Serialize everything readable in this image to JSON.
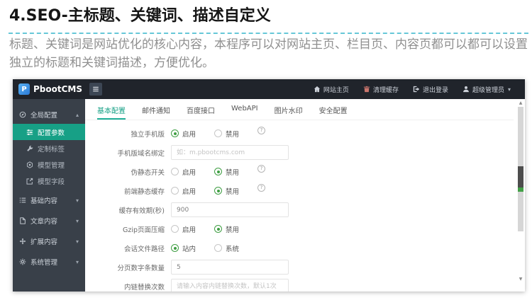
{
  "header": {
    "title": "4.SEO-主标题、关键词、描述自定义",
    "description": "标题、关键词是网站优化的核心内容，本程序可以对网站主页、栏目页、内容页都可以都可以设置独立的标题和关键词描述，方便优化。"
  },
  "admin": {
    "brand": {
      "name": "PbootCMS",
      "logo_letter": "P"
    },
    "glyphs": {
      "caret_up": "▴",
      "caret_down": "▾",
      "help": "?"
    },
    "scrollbar": {
      "up_glyph": "▲",
      "down_glyph": "▼"
    },
    "colors": {
      "accent": "#17a086",
      "radio_green": "#3f9e43",
      "navbar_bg": "#20242b",
      "sidebar_bg": "#394049",
      "divider_dash": "#56c2d4",
      "trash_icon": "#c9756d"
    },
    "topnav": {
      "items": [
        {
          "label": "网站主页",
          "icon": "home"
        },
        {
          "label": "清理缓存",
          "icon": "trash",
          "icon_color": "#c9756d"
        },
        {
          "label": "退出登录",
          "icon": "signout"
        },
        {
          "label": "超级管理员",
          "icon": "user",
          "caret": true
        }
      ]
    },
    "sidebar": {
      "items": [
        {
          "type": "group",
          "label": "全局配置",
          "icon": "compass",
          "expanded": true
        },
        {
          "type": "sub",
          "label": "配置参数",
          "icon": "sliders",
          "active": true
        },
        {
          "type": "sub",
          "label": "定制标签",
          "icon": "wrench"
        },
        {
          "type": "sub",
          "label": "模型管理",
          "icon": "nut"
        },
        {
          "type": "sub",
          "label": "模型字段",
          "icon": "external"
        },
        {
          "type": "group",
          "label": "基础内容",
          "icon": "list",
          "expanded": false
        },
        {
          "type": "group",
          "label": "文章内容",
          "icon": "file",
          "expanded": false
        },
        {
          "type": "group",
          "label": "扩展内容",
          "icon": "expand",
          "expanded": false
        },
        {
          "type": "group",
          "label": "系统管理",
          "icon": "gear",
          "expanded": false
        }
      ]
    },
    "tabs": [
      {
        "label": "基本配置",
        "active": true
      },
      {
        "label": "邮件通知",
        "active": false
      },
      {
        "label": "百度接口",
        "active": false
      },
      {
        "label": "WebAPI",
        "active": false
      },
      {
        "label": "图片水印",
        "active": false
      },
      {
        "label": "安全配置",
        "active": false
      }
    ],
    "form": {
      "rows": [
        {
          "type": "radio",
          "label": "独立手机版",
          "options": [
            {
              "label": "启用",
              "selected": true
            },
            {
              "label": "禁用",
              "selected": false
            }
          ],
          "help": true
        },
        {
          "type": "input",
          "label": "手机版域名绑定",
          "value": "",
          "placeholder": "如：m.pbootcms.com"
        },
        {
          "type": "radio",
          "label": "伪静态开关",
          "options": [
            {
              "label": "启用",
              "selected": false
            },
            {
              "label": "禁用",
              "selected": true
            }
          ],
          "help": true
        },
        {
          "type": "radio",
          "label": "前端静态缓存",
          "options": [
            {
              "label": "启用",
              "selected": false
            },
            {
              "label": "禁用",
              "selected": true
            }
          ],
          "help": true
        },
        {
          "type": "input",
          "label": "缓存有效期(秒)",
          "value": "900",
          "placeholder": ""
        },
        {
          "type": "radio",
          "label": "Gzip页面压缩",
          "options": [
            {
              "label": "启用",
              "selected": false
            },
            {
              "label": "禁用",
              "selected": true
            }
          ],
          "help": false
        },
        {
          "type": "radio",
          "label": "会话文件路径",
          "options": [
            {
              "label": "站内",
              "selected": true
            },
            {
              "label": "系统",
              "selected": false
            }
          ],
          "help": false
        },
        {
          "type": "input",
          "label": "分页数字条数量",
          "value": "5",
          "placeholder": ""
        },
        {
          "type": "input",
          "label": "内链替换次数",
          "value": "",
          "placeholder": "请输入内容内链替换次数，默认1次"
        }
      ]
    }
  }
}
